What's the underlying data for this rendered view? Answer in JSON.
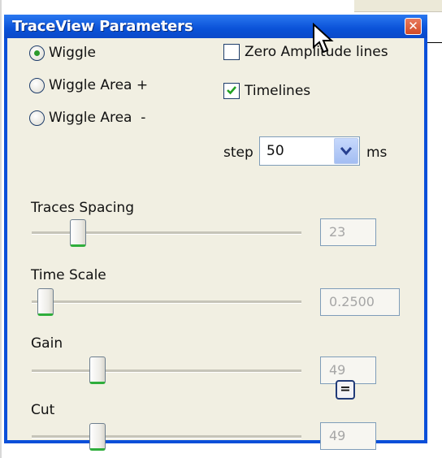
{
  "window": {
    "title": "TraceView Parameters",
    "close_symbol": "✕"
  },
  "display_mode": {
    "options": [
      "Wiggle",
      "Wiggle Area +",
      "Wiggle Area  -"
    ],
    "selected": "Wiggle"
  },
  "checkboxes": {
    "zero_amplitude": {
      "label": "Zero Amplitude lines",
      "checked": false
    },
    "timelines": {
      "label": "Timelines",
      "checked": true
    }
  },
  "step": {
    "label": "step",
    "value": "50",
    "unit": "ms"
  },
  "sliders": {
    "traces_spacing": {
      "label": "Traces Spacing",
      "value": "23"
    },
    "time_scale": {
      "label": "Time Scale",
      "value": "0.2500"
    },
    "gain": {
      "label": "Gain",
      "value": "49"
    },
    "cut": {
      "label": "Cut",
      "value": "49"
    }
  },
  "equal_button": {
    "label": "="
  },
  "colors": {
    "title_bar": "#0a52d8",
    "dialog_bg": "#f1efe2",
    "thumb_accent": "#2fae3c",
    "check_mark": "#21a121"
  }
}
